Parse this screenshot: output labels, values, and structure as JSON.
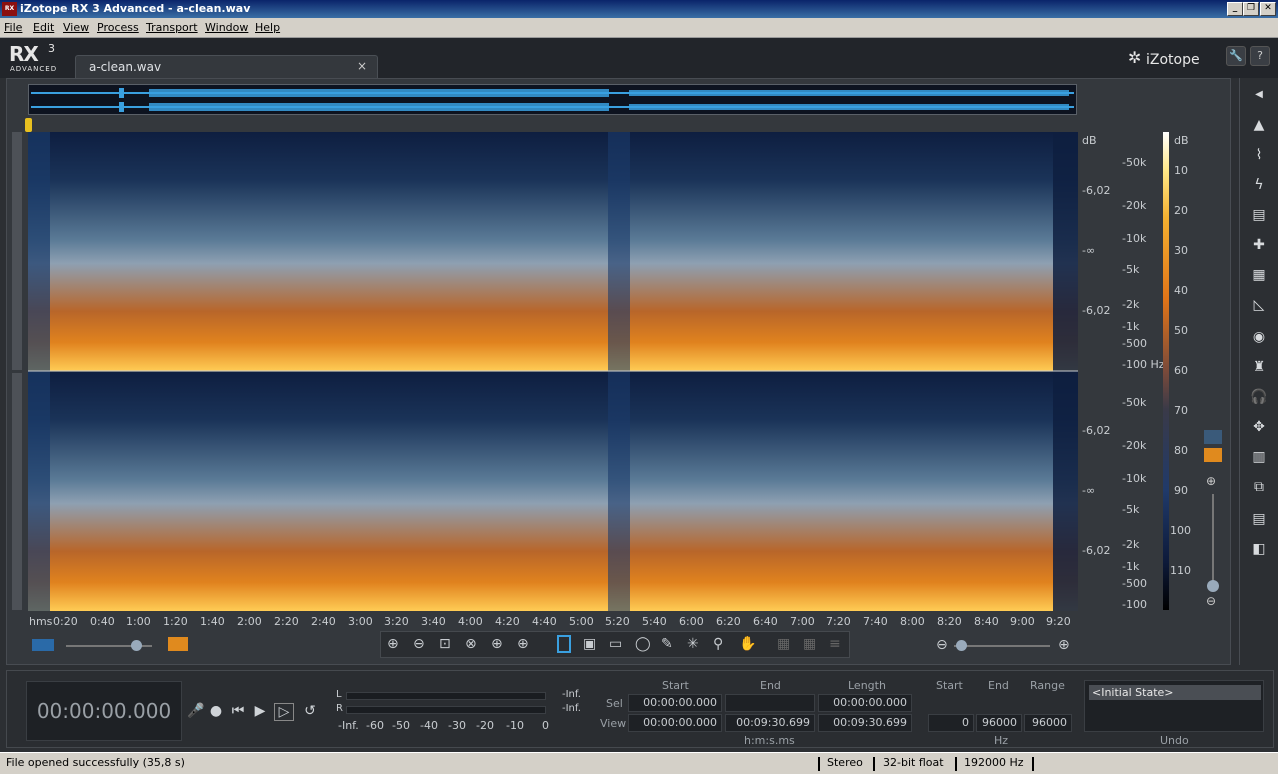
{
  "window": {
    "title": "iZotope RX 3 Advanced - a-clean.wav",
    "app_icon": "RX",
    "controls": {
      "minimize": "_",
      "restore": "❐",
      "close": "✕"
    }
  },
  "menu": [
    "File",
    "Edit",
    "View",
    "Process",
    "Transport",
    "Window",
    "Help"
  ],
  "header": {
    "logo_main": "RX",
    "logo_sup": "3",
    "logo_sub": "ADVANCED",
    "tab_label": "a-clean.wav",
    "tab_close": "×",
    "brand": "iZotope"
  },
  "db_scale_top": [
    "dB",
    "-6,02",
    "-∞",
    "-6,02"
  ],
  "db_scale_bottom": [
    "-6,02",
    "-∞",
    "-6,02"
  ],
  "freq_top": [
    "-50k",
    "-20k",
    "-10k",
    "-5k",
    "-2k",
    "-1k",
    "-500",
    "-100 Hz"
  ],
  "freq_bottom": [
    "-50k",
    "-20k",
    "-10k",
    "-5k",
    "-2k",
    "-1k",
    "-500",
    "-100"
  ],
  "colorbar_labels": [
    "dB",
    "10",
    "20",
    "30",
    "40",
    "50",
    "60",
    "70",
    "80",
    "90",
    "100",
    "110"
  ],
  "timeline": {
    "unit": "hms",
    "ticks": [
      "0:20",
      "0:40",
      "1:00",
      "1:20",
      "1:40",
      "2:00",
      "2:20",
      "2:40",
      "3:00",
      "3:20",
      "3:40",
      "4:00",
      "4:20",
      "4:40",
      "5:00",
      "5:20",
      "5:40",
      "6:00",
      "6:20",
      "6:40",
      "7:00",
      "7:20",
      "7:40",
      "8:00",
      "8:20",
      "8:40",
      "9:00",
      "9:20"
    ]
  },
  "colors": {
    "spectro_low": "#0e1e40",
    "spectro_mid": "#8ea0b2",
    "spectro_high": "#e0821e",
    "waveform": "#3aa0e0",
    "accent": "#e8c020"
  },
  "transport": {
    "timecode": "00:00:00.000",
    "buttons": {
      "record_arm": "🎤",
      "record": "●",
      "to_start": "⏮",
      "play": "▶",
      "play_selection": "▷",
      "loop": "↺"
    }
  },
  "meter": {
    "l": "L",
    "r": "R",
    "l_val": "-Inf.",
    "r_val": "-Inf.",
    "scale": [
      "-Inf.",
      "-60",
      "-50",
      "-40",
      "-30",
      "-20",
      "-10",
      "0"
    ]
  },
  "selection": {
    "headers": {
      "start": "Start",
      "end": "End",
      "length": "Length"
    },
    "sel_label": "Sel",
    "view_label": "View",
    "sel_start": "00:00:00.000",
    "sel_end": "",
    "sel_length": "00:00:00.000",
    "view_start": "00:00:00.000",
    "view_end": "00:09:30.699",
    "view_length": "00:09:30.699",
    "units": "h:m:s.ms"
  },
  "hz": {
    "headers": {
      "start": "Start",
      "end": "End",
      "range": "Range"
    },
    "start": "0",
    "end": "96000",
    "range": "96000",
    "units": "Hz"
  },
  "undo": {
    "item": "<Initial State>",
    "label": "Undo"
  },
  "status": {
    "message": "File opened successfully (35,8 s)",
    "channels": "Stereo",
    "format": "32-bit float",
    "rate": "192000 Hz"
  }
}
